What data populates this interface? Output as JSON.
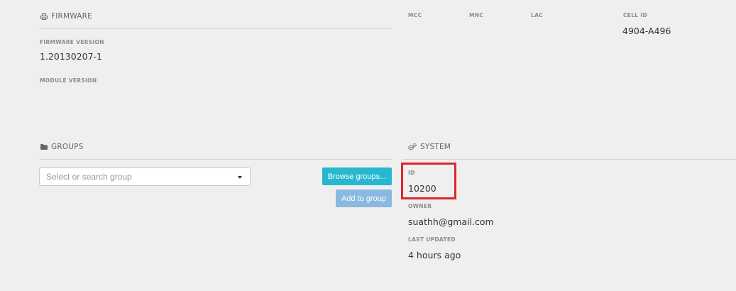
{
  "firmware": {
    "title": "FIRMWARE",
    "version_label": "FIRMWARE VERSION",
    "version_value": "1.20130207-1",
    "module_label": "MODULE VERSION",
    "module_value": ""
  },
  "network": {
    "mcc_label": "MCC",
    "mnc_label": "MNC",
    "lac_label": "LAC",
    "cell_label": "CELL ID",
    "cell_value": "4904-A496"
  },
  "groups": {
    "title": "GROUPS",
    "select_placeholder": "Select or search group",
    "browse_label": "Browse groups...",
    "add_label": "Add to group"
  },
  "system": {
    "title": "SYSTEM",
    "id_label": "ID",
    "id_value": "10200",
    "owner_label": "OWNER",
    "owner_value": "suathh@gmail.com",
    "updated_label": "LAST UPDATED",
    "updated_value": "4 hours ago"
  },
  "colors": {
    "browse_button": "#27b8cf",
    "add_button": "#8ab8e0",
    "highlight_box": "#e0252b",
    "background": "#efefef"
  },
  "icons": {
    "firmware": "printer-icon",
    "groups": "folder-icon",
    "system": "gears-icon",
    "select_caret": "caret-down-icon"
  }
}
